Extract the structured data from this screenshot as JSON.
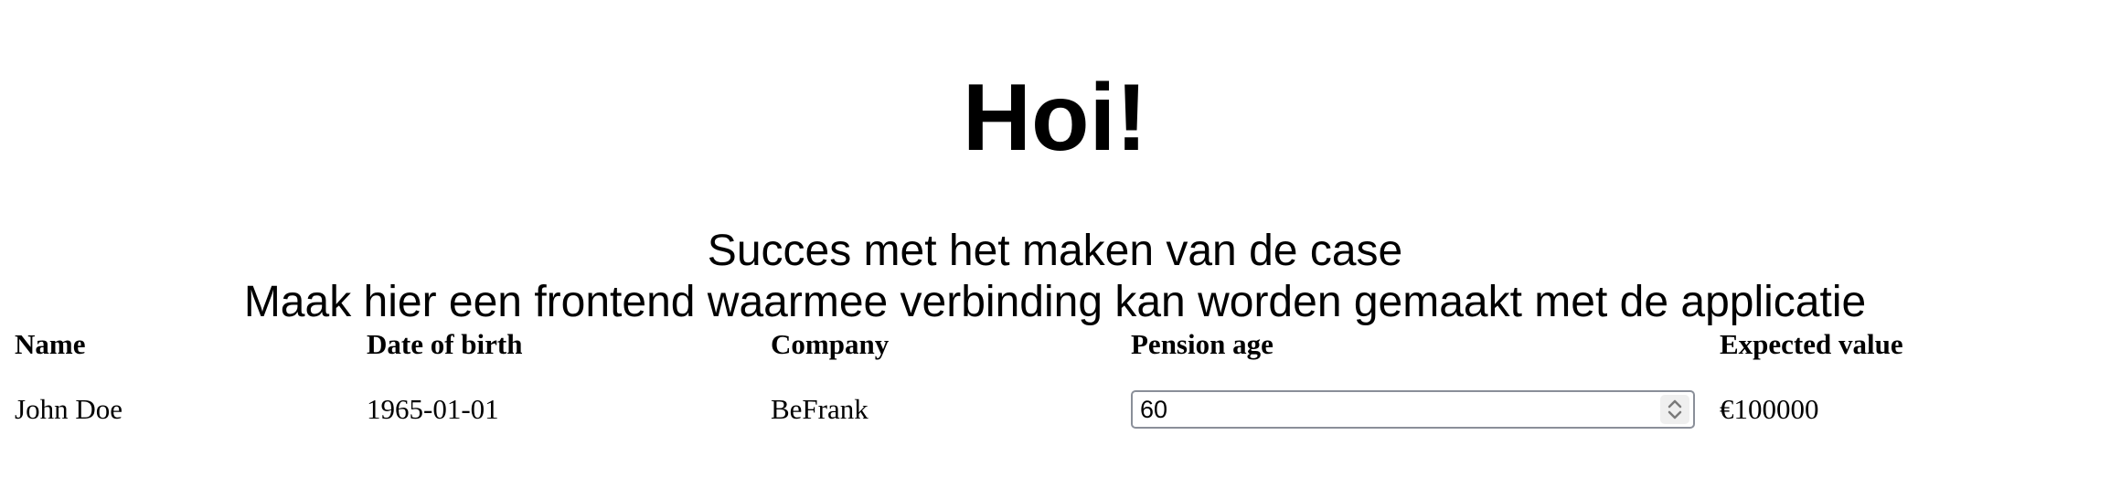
{
  "header": {
    "title": "Hoi!",
    "subtitle": "Succes met het maken van de case",
    "description": "Maak hier een frontend waarmee verbinding kan worden gemaakt met de applicatie"
  },
  "table": {
    "headers": [
      "Name",
      "Date of birth",
      "Company",
      "Pension age",
      "Expected value"
    ],
    "rows": [
      {
        "name": "John Doe",
        "date_of_birth": "1965-01-01",
        "company": "BeFrank",
        "pension_age": "60",
        "expected_value": "€100000"
      }
    ]
  },
  "icons": {
    "spinner": "chevron-up-down-icon"
  },
  "colors": {
    "input_border": "#8a8f99",
    "spinner_bg": "#efefef"
  }
}
